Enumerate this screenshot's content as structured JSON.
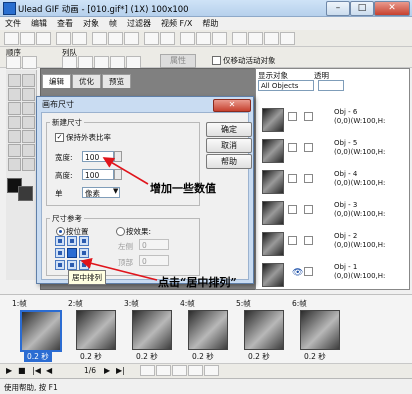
{
  "window": {
    "title": "Ulead GIF 动画 - [010.gif*] (1X) 100x100"
  },
  "menu": [
    "文件",
    "编辑",
    "查看",
    "对象",
    "帧",
    "过滤器",
    "视频 F/X",
    "帮助"
  ],
  "toolbar2": {
    "sequence_label": "顺序",
    "column_label": "列队",
    "attr_label": "属性",
    "move_obj_label": "仅移动活动对象"
  },
  "tabs": [
    "编辑",
    "优化",
    "预览"
  ],
  "right_panel": {
    "display_label": "显示对象",
    "transparent_label": "透明",
    "select_value": "All Objects",
    "objects": [
      {
        "name": "Obj - 6",
        "info": "(0,0)(W:100,H:"
      },
      {
        "name": "Obj - 5",
        "info": "(0,0)(W:100,H:"
      },
      {
        "name": "Obj - 4",
        "info": "(0,0)(W:100,H:"
      },
      {
        "name": "Obj - 3",
        "info": "(0,0)(W:100,H:"
      },
      {
        "name": "Obj - 2",
        "info": "(0,0)(W:100,H:"
      },
      {
        "name": "Obj - 1",
        "info": "(0,0)(W:100,H:"
      }
    ]
  },
  "dialog": {
    "title": "画布尺寸",
    "close": "✕",
    "new_size_label": "新建尺寸",
    "keep_ratio_label": "保持外表比率",
    "width_label": "宽度:",
    "width_value": "100",
    "height_label": "高度:",
    "height_value": "100",
    "unit_label": "单",
    "unit_value": "像素",
    "ok": "确定",
    "cancel": "取消",
    "help": "帮助",
    "ref_label": "尺寸参考",
    "by_position": "按位置",
    "by_effect": "按效果:",
    "left_label": "左侧",
    "left_value": "0",
    "top_label": "顶部",
    "top_value": "0",
    "tooltip": "居中排列"
  },
  "annotations": {
    "add_value": "增加一些数值",
    "click_center": "点击“居中排列”"
  },
  "frames": [
    {
      "label": "1:帧",
      "delay": "0.2 秒"
    },
    {
      "label": "2:帧",
      "delay": "0.2 秒"
    },
    {
      "label": "3:帧",
      "delay": "0.2 秒"
    },
    {
      "label": "4:帧",
      "delay": "0.2 秒"
    },
    {
      "label": "5:帧",
      "delay": "0.2 秒"
    },
    {
      "label": "6:帧",
      "delay": "0.2 秒"
    }
  ],
  "playback": {
    "counter": "1/6"
  },
  "status": {
    "text": "使用帮助, 按 F1"
  },
  "colors": {
    "accent": "#2b6cd2",
    "arrow": "#e0141b"
  }
}
